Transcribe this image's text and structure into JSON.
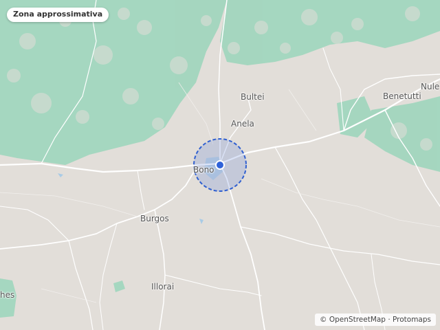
{
  "map": {
    "badge_label": "Zona approssimativa",
    "attribution": "© OpenStreetMap · Protomaps",
    "places": {
      "bultei": "Bultei",
      "anela": "Anela",
      "benetutti": "Benetutti",
      "nule": "Nule",
      "bono": "Bono",
      "burgos": "Burgos",
      "illorai": "Illorai",
      "left_edge": "hes"
    },
    "colors": {
      "land": "#e2ded9",
      "forest": "#9fd6bd",
      "road": "#ffffff",
      "water": "#a9cbe6",
      "accuracy_fill": "#5b7fd9",
      "accuracy_stroke": "#2f5fd0",
      "location_dot": "#2f62d8"
    }
  }
}
